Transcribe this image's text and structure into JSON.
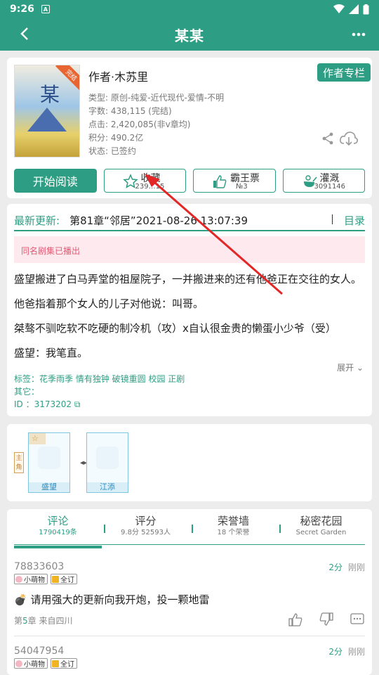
{
  "status": {
    "time": "9:26"
  },
  "header": {
    "title": "某某"
  },
  "book": {
    "author": "作者·木苏里",
    "author_column_btn": "作者专栏",
    "cover_ribbon": "完结",
    "meta": [
      "类型: 原创-纯爱-近代现代-爱情-不明",
      "字数: 438,115 (完结)",
      "点击: 2,420,085(非v章均)",
      "积分: 490.2亿",
      "状态: 已签约"
    ]
  },
  "actions": {
    "read": "开始阅读",
    "collect": {
      "label": "收藏",
      "count": "239…15"
    },
    "ticket": {
      "label": "霸王票",
      "rank": "№3"
    },
    "water": {
      "label": "灌溉",
      "count": "3091146"
    }
  },
  "update": {
    "label": "最新更新:",
    "value": "第81章“邻居”2021-08-26 13:07:39",
    "toc": "目录"
  },
  "notice": "同名剧集已播出",
  "intro": [
    "盛望搬进了白马弄堂的祖屋院子，一并搬进来的还有他爸正在交往的女人。",
    "他爸指着那个女人的儿子对他说：叫哥。",
    "桀骜不驯吃软不吃硬的制冷机（攻）x自认很金贵的懒蛋小少爷（受）",
    "盛望：我笔直。"
  ],
  "expand": "展开",
  "tags": {
    "tags_line": "标签：花季雨季 情有独钟 破镜重圆 校园 正剧",
    "other_line": "其它：",
    "id_line": "ID   ：3173202"
  },
  "roles": {
    "lead_badge": "主角",
    "left": "盛望",
    "right": "江添",
    "link": "◂▸"
  },
  "tabs": [
    {
      "title": "评论",
      "sub": "1790419条"
    },
    {
      "title": "评分",
      "sub": "9.8分 52593人"
    },
    {
      "title": "荣誉墙",
      "sub": "18 个荣誉"
    },
    {
      "title": "秘密花园",
      "sub": "Secret Garden"
    }
  ],
  "comments": [
    {
      "user": "78833603",
      "score": "2分",
      "time": "刚刚",
      "badge1": "小萌物",
      "badge2": "全订",
      "text": "💣 请用强大的更新向我开炮，投一颗地雷",
      "chapter_prefix": "第",
      "chapter": "5",
      "chapter_suffix": "章  来自四川"
    },
    {
      "user": "54047954",
      "score": "2分",
      "time": "刚刚",
      "badge1": "小萌物",
      "badge2": "全订"
    }
  ],
  "colors": {
    "accent": "#2d9e83",
    "notice_bg": "#fde9ee",
    "notice_text": "#e35b74",
    "arrow": "#e32626"
  }
}
